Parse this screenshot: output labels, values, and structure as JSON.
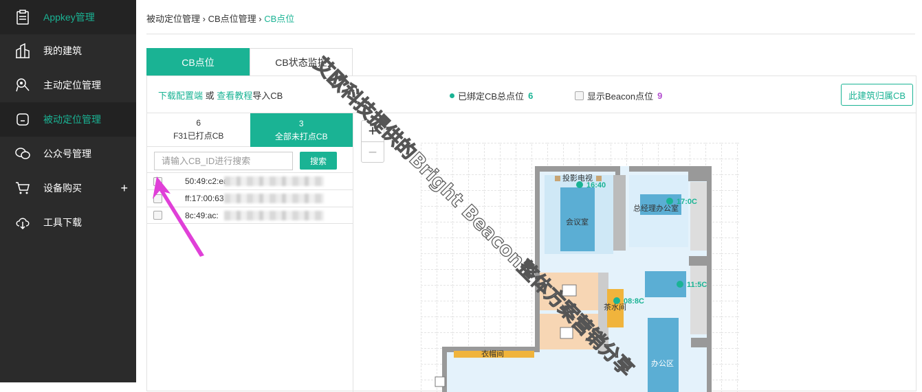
{
  "sidebar": {
    "items": [
      {
        "label": "Appkey管理",
        "icon": "clipboard-icon"
      },
      {
        "label": "我的建筑",
        "icon": "building-icon"
      },
      {
        "label": "主动定位管理",
        "icon": "location-pin-icon"
      },
      {
        "label": "被动定位管理",
        "icon": "device-icon"
      },
      {
        "label": "公众号管理",
        "icon": "wechat-icon"
      },
      {
        "label": "设备购买",
        "icon": "cart-icon",
        "expand": "+"
      },
      {
        "label": "工具下载",
        "icon": "cloud-download-icon"
      }
    ]
  },
  "breadcrumb": {
    "part1": "被动定位管理",
    "sep": " › ",
    "part2": "CB点位管理",
    "part3": "CB点位"
  },
  "tabs": [
    {
      "label": "CB点位"
    },
    {
      "label": "CB状态监控"
    }
  ],
  "toolbar": {
    "download_link": "下载配置端",
    "or_text": " 或 ",
    "tutorial_link": "查看教程",
    "import_text": "导入CB",
    "bound_label": "已绑定CB总点位",
    "bound_count": "6",
    "beacon_label": "显示Beacon点位",
    "beacon_count": "9",
    "owner_button": "此建筑归属CB"
  },
  "sub_tabs": [
    {
      "count": "6",
      "label": "F31已打点CB"
    },
    {
      "count": "3",
      "label": "全部未打点CB"
    }
  ],
  "search": {
    "placeholder": "请输入CB_ID进行搜索",
    "button": "搜索"
  },
  "cb_list": [
    {
      "mac": "50:49:c2:ea:3"
    },
    {
      "mac": "ff:17:00:63"
    },
    {
      "mac": "8c:49:ac:"
    }
  ],
  "map": {
    "zoom_in": "+",
    "zoom_out": "−",
    "rooms": {
      "projector": "投影电视",
      "meeting": "会议室",
      "gm_office": "总经理办公室",
      "tea_room": "茶水间",
      "cloakroom": "衣帽间",
      "office": "办公区"
    },
    "beacons": [
      "16:40",
      "17:0C",
      "11:5C",
      "08:8C"
    ]
  },
  "watermark": "艾欧科技提供的Bright Beacon整体方案营销分享",
  "colors": {
    "accent": "#1ab394",
    "sidebar": "#2b2b2b",
    "beacon_count": "#b44fd0",
    "arrow": "#e040d8"
  }
}
